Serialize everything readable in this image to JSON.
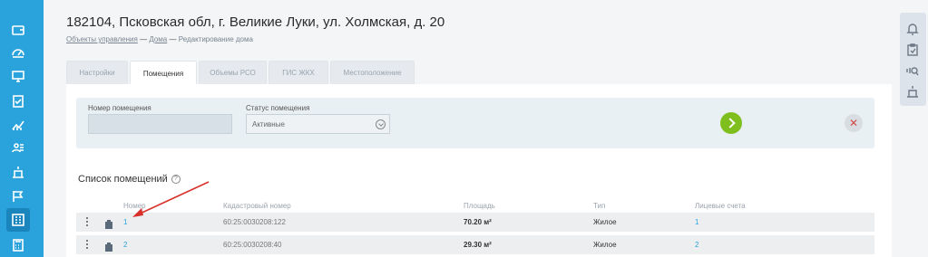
{
  "sidebar": {
    "items": [
      {
        "icon": "wallet-icon"
      },
      {
        "icon": "gauge-icon"
      },
      {
        "icon": "monitor-icon"
      },
      {
        "icon": "checklist-icon"
      },
      {
        "icon": "analytics-icon"
      },
      {
        "icon": "users-icon"
      },
      {
        "icon": "building-icon"
      },
      {
        "icon": "flag-icon"
      },
      {
        "icon": "apartments-icon",
        "active": true
      },
      {
        "icon": "calculator-icon"
      }
    ]
  },
  "rightbar": {
    "items": [
      {
        "icon": "bell-icon"
      },
      {
        "icon": "clipboard-icon"
      },
      {
        "icon": "support-icon"
      },
      {
        "icon": "building-icon"
      }
    ]
  },
  "header": {
    "title": "182104, Псковская обл, г. Великие Луки, ул. Холмская, д. 20",
    "breadcrumb": [
      {
        "label": "Объекты управления",
        "link": true
      },
      {
        "label": "Дома",
        "link": true
      },
      {
        "label": "Редактирование дома",
        "link": false
      }
    ],
    "separator": "—"
  },
  "tabs": [
    {
      "label": "Настройки",
      "active": false
    },
    {
      "label": "Помещения",
      "active": true
    },
    {
      "label": "Объемы РСО",
      "active": false
    },
    {
      "label": "ГИС ЖКХ",
      "active": false
    },
    {
      "label": "Местоположение",
      "active": false
    }
  ],
  "filters": {
    "room_number_label": "Номер помещения",
    "room_number_value": "",
    "room_status_label": "Статус помещения",
    "room_status_value": "Активные",
    "clear_symbol": "✕"
  },
  "list": {
    "title": "Список помещений",
    "help_symbol": "?",
    "columns": {
      "number": "Номер",
      "cadastral": "Кадастровый номер",
      "area": "Площадь",
      "type": "Тип",
      "accounts": "Лицевые счета"
    },
    "rows": [
      {
        "number": "1",
        "cadastral": "60:25:0030208:122",
        "area": "70.20 м²",
        "type": "Жилое",
        "accounts": "1"
      },
      {
        "number": "2",
        "cadastral": "60:25:0030208:40",
        "area": "29.30 м²",
        "type": "Жилое",
        "accounts": "2"
      }
    ]
  },
  "colors": {
    "sidebar": "#2aa2dc",
    "accent_link": "#2aa2dc",
    "go_button": "#7fbf1d",
    "annotation_arrow": "#d8312c"
  }
}
